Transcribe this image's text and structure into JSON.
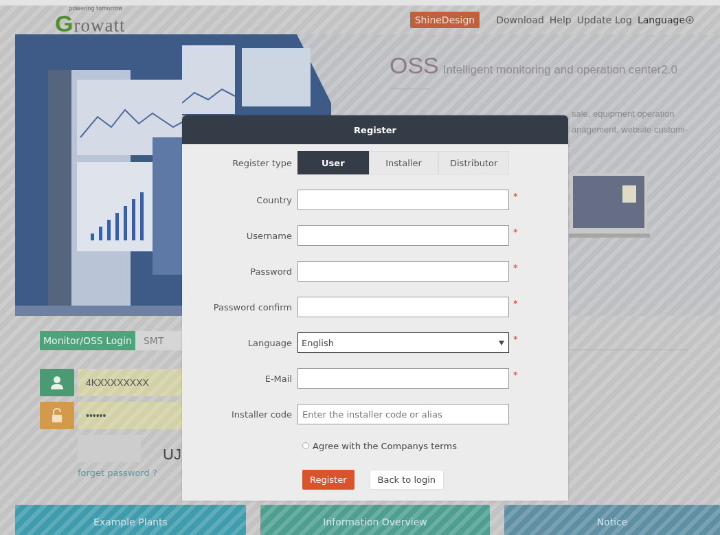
{
  "header": {
    "logo": "Growatt",
    "tagline": "powering tomorrow",
    "nav": [
      {
        "label": "ShineDesign",
        "kind": "highlight"
      },
      {
        "label": "Download",
        "kind": "link"
      },
      {
        "label": "Help",
        "kind": "link"
      },
      {
        "label": "Update Log",
        "kind": "link"
      },
      {
        "label": "Language",
        "kind": "menu"
      }
    ]
  },
  "banner": {
    "brand": "OSS",
    "headline": "Intelligent monitoring and operation center2.0",
    "lines": [
      "sale, equipment operation",
      "anagement, website customi-"
    ]
  },
  "login": {
    "tabs": [
      {
        "label": "Monitor/OSS Login",
        "selected": true
      },
      {
        "label": "SMT",
        "selected": false
      }
    ],
    "username": "4KXXXXXXXX",
    "password": "••••••",
    "captcha": "UJ",
    "forgot": "forget password ?"
  },
  "tiles": [
    {
      "label": "Example Plants",
      "color": "#3f9cac"
    },
    {
      "label": "Information Overview",
      "color": "#4f9f90"
    },
    {
      "label": "Notice",
      "color": "#5f8fa3"
    }
  ],
  "dialog": {
    "title": "Register",
    "type_label": "Register type",
    "required_mark": "*",
    "types": [
      {
        "label": "User",
        "selected": true
      },
      {
        "label": "Installer",
        "selected": false
      },
      {
        "label": "Distributor",
        "selected": false
      }
    ],
    "fields": [
      {
        "label": "Country",
        "kind": "text",
        "required": true
      },
      {
        "label": "Username",
        "kind": "text",
        "required": true
      },
      {
        "label": "Password",
        "kind": "text",
        "required": true
      },
      {
        "label": "Password confirm",
        "kind": "text",
        "required": true
      },
      {
        "label": "Language",
        "kind": "select",
        "value": "English",
        "required": true
      },
      {
        "label": "E-Mail",
        "kind": "text",
        "required": true
      },
      {
        "label": "Installer code",
        "kind": "text",
        "placeholder": "Enter the installer code or alias",
        "required": false
      }
    ],
    "agree": {
      "label": "Agree with the Companys terms",
      "checked": false
    },
    "buttons": [
      {
        "label": "Register",
        "kind": "primary"
      },
      {
        "label": "Back to login",
        "kind": "secondary"
      }
    ]
  }
}
